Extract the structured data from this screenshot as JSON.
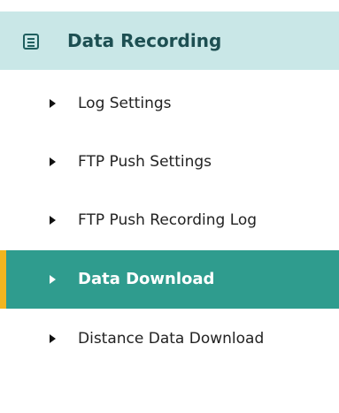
{
  "section": {
    "title": "Data Recording",
    "icon": "list-panel-icon"
  },
  "items": [
    {
      "label": "Log Settings",
      "active": false
    },
    {
      "label": "FTP Push Settings",
      "active": false
    },
    {
      "label": "FTP Push Recording Log",
      "active": false
    },
    {
      "label": "Data Download",
      "active": true
    },
    {
      "label": "Distance Data Download",
      "active": false
    }
  ],
  "colors": {
    "header_bg": "#c9e7e7",
    "header_text": "#1d4f52",
    "active_bg": "#2f9c8e",
    "active_accent": "#f2b51f",
    "active_text": "#ffffff",
    "item_text": "#222222"
  }
}
